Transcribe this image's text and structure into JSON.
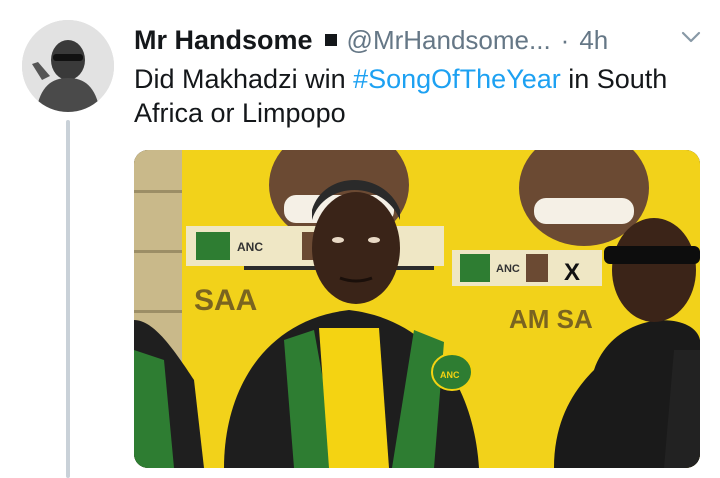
{
  "tweet": {
    "author_name": "Mr Handsome",
    "author_handle": "@MrHandsome...",
    "time_separator": "·",
    "timestamp": "4h",
    "text_before": "Did Makhadzi win ",
    "hashtag": "#SongOfTheYear",
    "text_after": " in South Africa or Limpopo"
  },
  "media": {
    "poster_text_left": "SAA",
    "poster_text_right": "AM SA",
    "badge_text": "ANC",
    "colors": {
      "poster_yellow": "#f2d21a",
      "shirt_yellow": "#f4d312",
      "anc_green": "#2e7d32",
      "jacket_black": "#1e1e1e"
    }
  },
  "icons": [
    "caret-down-icon",
    "verified-badge-icon"
  ],
  "colors": {
    "accent": "#1da1f2",
    "secondary_text": "#657786",
    "thread_line": "#c9d1d8"
  }
}
